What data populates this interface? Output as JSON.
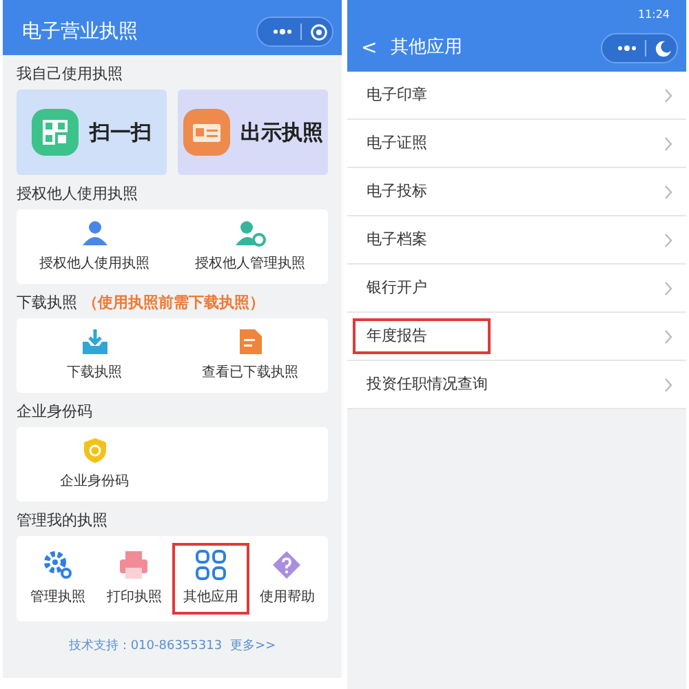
{
  "left_screen": {
    "title": "电子营业执照",
    "sections": [
      {
        "label": "我自己使用执照",
        "kind": "big",
        "items": [
          {
            "label": "扫一扫",
            "highlighted": false
          },
          {
            "label": "出示执照",
            "highlighted": false
          }
        ]
      },
      {
        "label": "授权他人使用执照",
        "kind": "grid",
        "items": [
          {
            "label": "授权他人使用执照",
            "highlighted": false
          },
          {
            "label": "授权他人管理执照",
            "highlighted": false
          }
        ]
      },
      {
        "label": "下载执照",
        "note": "（使用执照前需下载执照）",
        "kind": "grid",
        "items": [
          {
            "label": "下载执照",
            "highlighted": false
          },
          {
            "label": "查看已下载执照",
            "highlighted": false
          }
        ]
      },
      {
        "label": "企业身份码",
        "kind": "grid",
        "items": [
          {
            "label": "企业身份码",
            "highlighted": false
          }
        ]
      },
      {
        "label": "管理我的执照",
        "kind": "grid4",
        "items": [
          {
            "label": "管理执照",
            "highlighted": false
          },
          {
            "label": "打印执照",
            "highlighted": false
          },
          {
            "label": "其他应用",
            "highlighted": true
          },
          {
            "label": "使用帮助",
            "highlighted": false
          }
        ]
      }
    ],
    "footer": {
      "support": "技术支持：010-86355313",
      "more": "更多>>"
    }
  },
  "right_screen": {
    "status_time": "11:24",
    "back": "<",
    "title": "其他应用",
    "items": [
      {
        "label": "电子印章",
        "highlighted": false
      },
      {
        "label": "电子证照",
        "highlighted": false
      },
      {
        "label": "电子投标",
        "highlighted": false
      },
      {
        "label": "电子档案",
        "highlighted": false
      },
      {
        "label": "银行开户",
        "highlighted": false
      },
      {
        "label": "年度报告",
        "highlighted": true
      },
      {
        "label": "投资任职情况查询",
        "highlighted": false
      }
    ]
  }
}
